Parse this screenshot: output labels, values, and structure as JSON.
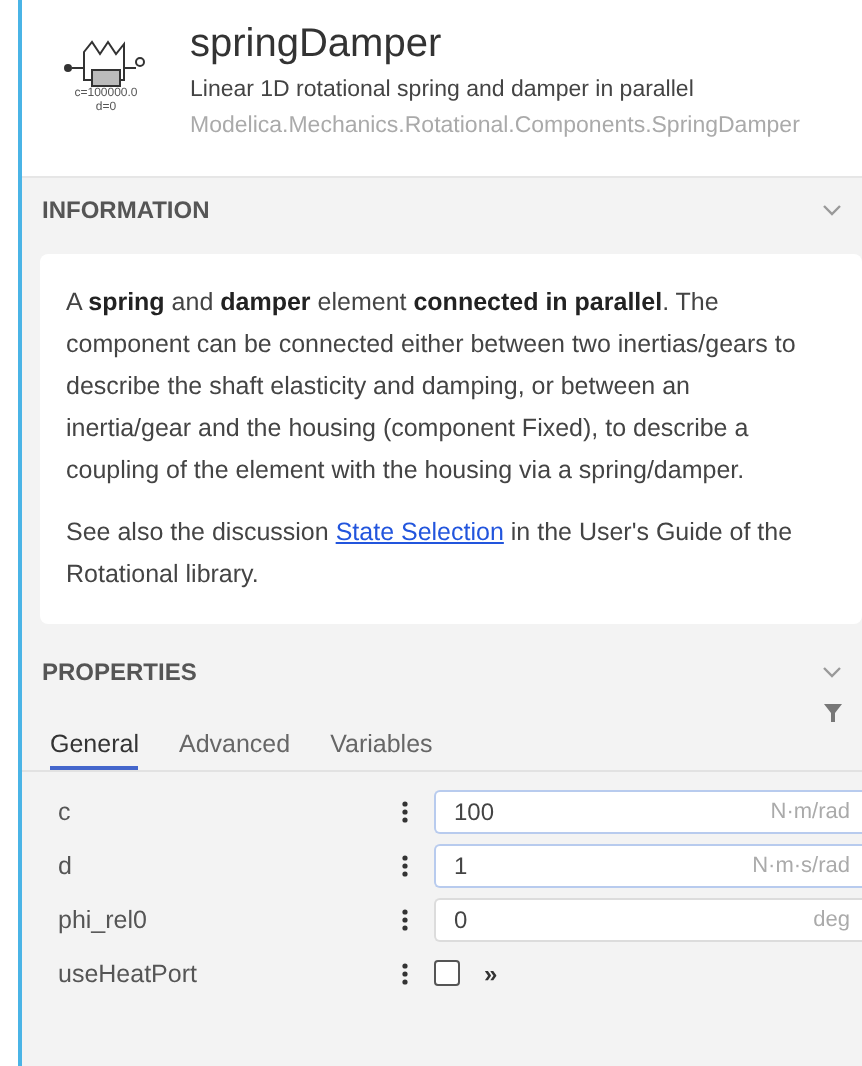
{
  "header": {
    "title": "springDamper",
    "description": "Linear 1D rotational spring and damper in parallel",
    "class_path": "Modelica.Mechanics.Rotational.Components.SpringDamper",
    "icon_labels": [
      "c=100000.0",
      "d=0"
    ]
  },
  "information": {
    "heading": "INFORMATION",
    "expanded": true,
    "paragraphs": [
      {
        "text": "A **spring** and **damper** element **connected in parallel**. The component can be connected either between two inertias/gears to describe the shaft elasticity and damping, or between an inertia/gear and the housing (component Fixed), to describe a coupling of the element with the housing via a spring/damper."
      },
      {
        "text": "See also the discussion",
        "link": "State Selection",
        "after": "in the User's Guide of the Rotational library."
      }
    ]
  },
  "properties": {
    "heading": "PROPERTIES",
    "expanded": true,
    "tabs": [
      {
        "label": "General",
        "selected": true
      },
      {
        "label": "Advanced",
        "selected": false
      },
      {
        "label": "Variables",
        "selected": false
      }
    ],
    "rows": [
      {
        "kind": "value",
        "name": "c",
        "value": "100",
        "unit": "N·m/rad",
        "modified": true
      },
      {
        "kind": "value",
        "name": "d",
        "value": "1",
        "unit": "N·m·s/rad",
        "modified": true
      },
      {
        "kind": "value",
        "name": "phi_rel0",
        "value": "0",
        "unit": "deg",
        "modified": false
      },
      {
        "kind": "checkbox",
        "name": "useHeatPort",
        "checked": false,
        "more": "»"
      }
    ]
  }
}
